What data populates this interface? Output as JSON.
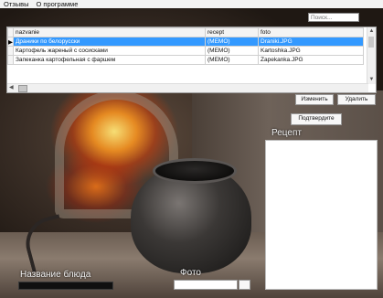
{
  "menu": {
    "items": [
      {
        "label": "Отзывы"
      },
      {
        "label": "О программе"
      }
    ]
  },
  "search": {
    "placeholder": "Поиск..."
  },
  "grid": {
    "columns": [
      "nazvanie",
      "recept",
      "foto"
    ],
    "rows": [
      {
        "nazvanie": "Драники по белорусски",
        "recept": "(MEMO)",
        "foto": "Draniki.JPG",
        "selected": true
      },
      {
        "nazvanie": "Картофель жареный с сосисками",
        "recept": "(MEMO)",
        "foto": "Kartoshka.JPG",
        "selected": false
      },
      {
        "nazvanie": "Запеканка картофельная с фаршем",
        "recept": "(MEMO)",
        "foto": "Zapekanka.JPG",
        "selected": false
      }
    ]
  },
  "buttons": {
    "edit": "Изменить",
    "delete": "Удалить",
    "confirm": "Подтвердите"
  },
  "labels": {
    "recipe": "Рецепт",
    "dish_name": "Название блюда",
    "photo": "Фото"
  },
  "colors": {
    "selection": "#3399ff",
    "menubar": "#f3f3f3"
  }
}
